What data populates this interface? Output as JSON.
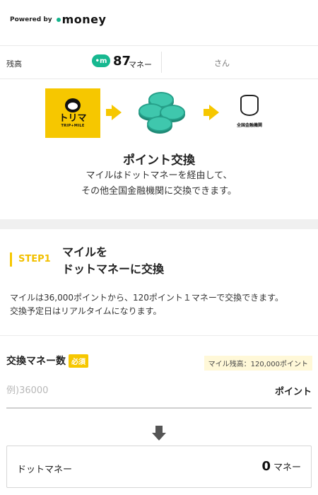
{
  "header": {
    "powered_by": "Powered by",
    "logo_text": "money"
  },
  "balance": {
    "label": "残高",
    "coin_icon_text": "•m",
    "amount": "87",
    "unit": "マネー",
    "user_suffix": "さん"
  },
  "flow": {
    "source_name": "トリマ",
    "source_sub": "TRIP+MILE",
    "bank_label": "全国金融機関",
    "icons": [
      "torima-logo-icon",
      "arrow-right-icon",
      "coins-icon",
      "arrow-right-icon",
      "bank-icon"
    ],
    "accent_color": "#f6c700",
    "money_color": "#17b890"
  },
  "intro": {
    "title": "ポイント交換",
    "description_line1": "マイルはドットマネーを経由して、",
    "description_line2": "その他全国金融機関に交換できます。"
  },
  "step": {
    "tag": "STEP1",
    "heading_line1": "マイルを",
    "heading_line2": "ドットマネーに交換",
    "info_line1": "マイルは36,000ポイントから、120ポイント１マネーで交換できます。",
    "info_line2": "交換予定日はリアルタイムになります。"
  },
  "form": {
    "amount_label": "交換マネー数",
    "required_badge": "必須",
    "mile_balance": "マイル残高：120,000ポイント",
    "input_placeholder": "例)36000",
    "input_value": "",
    "input_unit": "ポイント"
  },
  "result": {
    "label": "ドットマネー",
    "value": "0",
    "unit": "マネー"
  }
}
